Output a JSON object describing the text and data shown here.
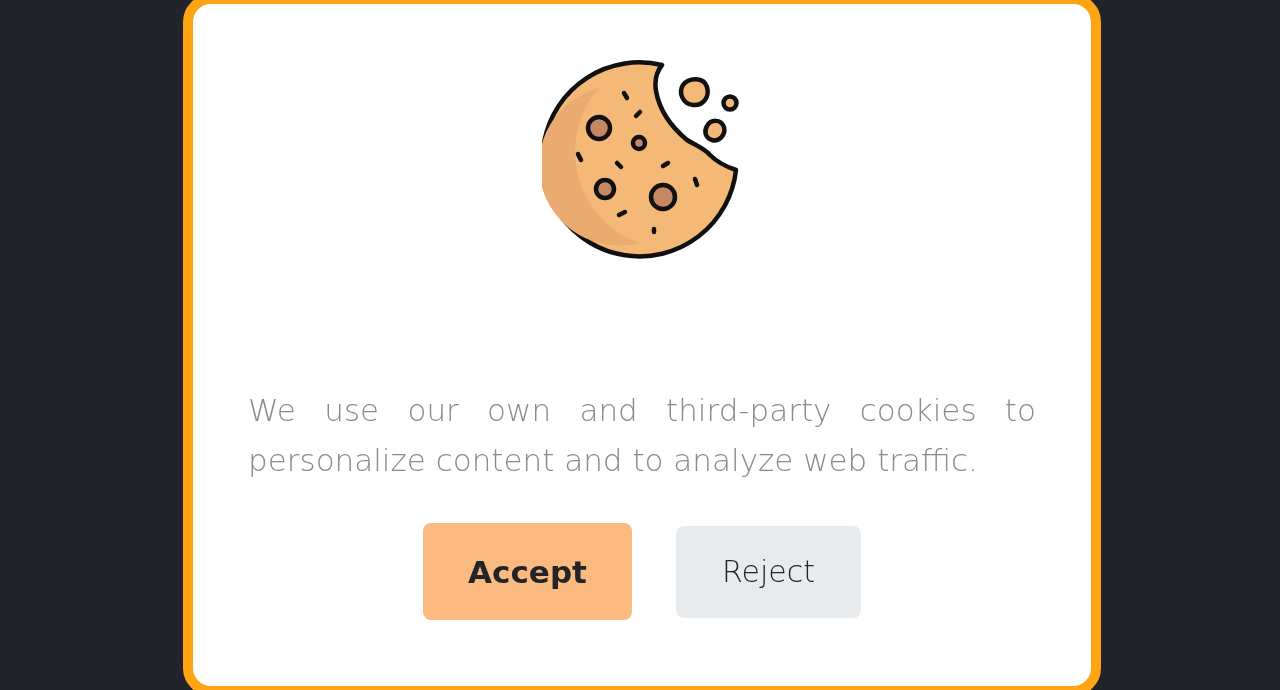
{
  "cookie_notice": {
    "message": "We use our own and third-party cookies to personalize content and to analyze web traffic.",
    "buttons": [
      {
        "label": "Accept",
        "kind": "primary"
      },
      {
        "label": "Reject",
        "kind": "secondary"
      }
    ]
  }
}
